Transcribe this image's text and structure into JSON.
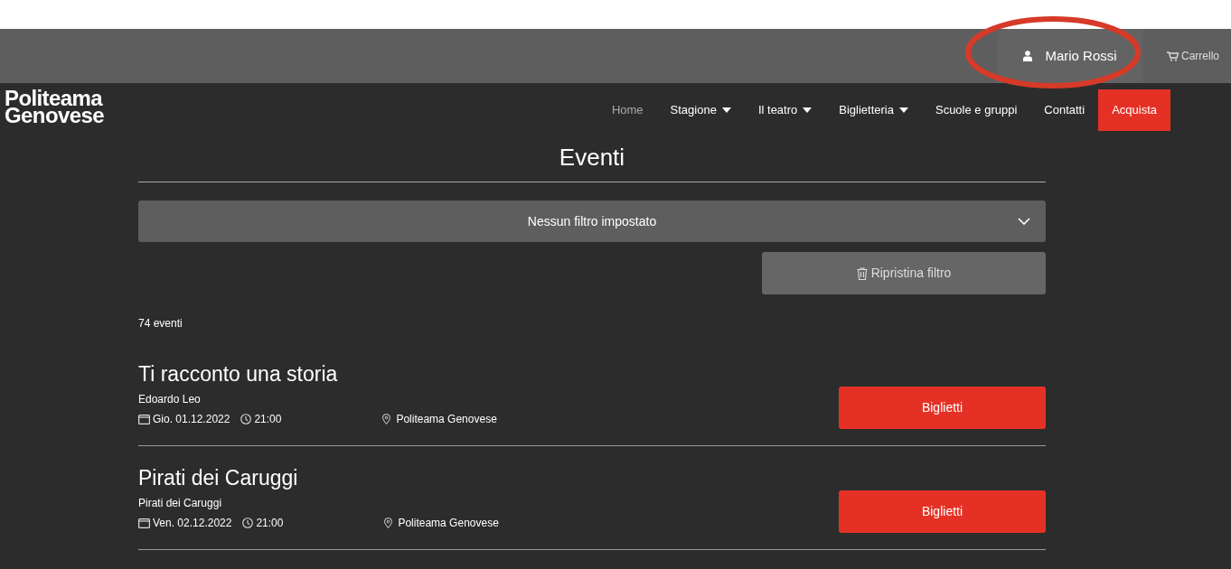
{
  "top_bar": {
    "user": "Mario Rossi",
    "cart": "Carrello"
  },
  "logo": {
    "line1": "Politeama",
    "line2": "Genovese"
  },
  "nav": [
    {
      "label": "Home",
      "kind": "link",
      "selected": true
    },
    {
      "label": "Stagione",
      "kind": "dropdown",
      "selected": false
    },
    {
      "label": "Il teatro",
      "kind": "dropdown",
      "selected": false
    },
    {
      "label": "Biglietteria",
      "kind": "dropdown",
      "selected": false
    },
    {
      "label": "Scuole e gruppi",
      "kind": "link",
      "selected": false
    },
    {
      "label": "Contatti",
      "kind": "link",
      "selected": false
    },
    {
      "label": "Acquista",
      "kind": "cta",
      "selected": false
    }
  ],
  "page_title": "Eventi",
  "filter": {
    "value": "Nessun filtro impostato",
    "reset_button": "Ripristina filtro"
  },
  "count": "74 eventi",
  "events": [
    {
      "title": "Ti racconto una storia",
      "artist": "Edoardo Leo",
      "date": "Gio. 01.12.2022",
      "time": "21:00",
      "venue": "Politeama Genovese",
      "button": "Biglietti"
    },
    {
      "title": "Pirati dei Caruggi",
      "artist": "Pirati dei Caruggi",
      "date": "Ven. 02.12.2022",
      "time": "21:00",
      "venue": "Politeama Genovese",
      "button": "Biglietti"
    }
  ],
  "annotation": {
    "kind": "ellipse"
  }
}
